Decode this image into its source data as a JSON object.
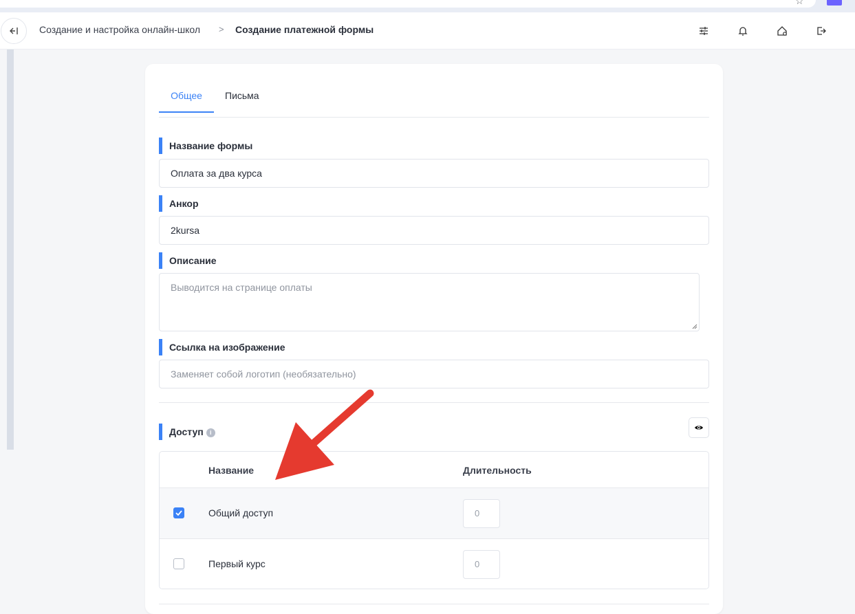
{
  "breadcrumb": {
    "parent": "Создание и настройка онлайн-школ",
    "separator": ">",
    "current": "Создание платежной формы"
  },
  "toolbar": {
    "back_icon": "collapse-left-icon",
    "icons": [
      "sliders-icon",
      "bell-icon",
      "home-settings-icon",
      "logout-icon"
    ]
  },
  "tabs": [
    {
      "label": "Общее",
      "active": true
    },
    {
      "label": "Письма",
      "active": false
    }
  ],
  "form": {
    "name": {
      "label": "Название формы",
      "value": "Оплата за два курса"
    },
    "anchor": {
      "label": "Анкор",
      "value": "2kursa"
    },
    "description": {
      "label": "Описание",
      "placeholder": "Выводится на странице оплаты"
    },
    "image": {
      "label": "Ссылка на изображение",
      "placeholder": "Заменяет собой логотип (необязательно)"
    }
  },
  "access": {
    "label": "Доступ",
    "columns": {
      "name": "Название",
      "duration": "Длительность"
    },
    "rows": [
      {
        "name": "Общий доступ",
        "checked": true,
        "duration": "0"
      },
      {
        "name": "Первый курс",
        "checked": false,
        "duration": "0"
      }
    ]
  },
  "colors": {
    "accent": "#3b82f6",
    "annotation_arrow": "#e53a2f"
  }
}
